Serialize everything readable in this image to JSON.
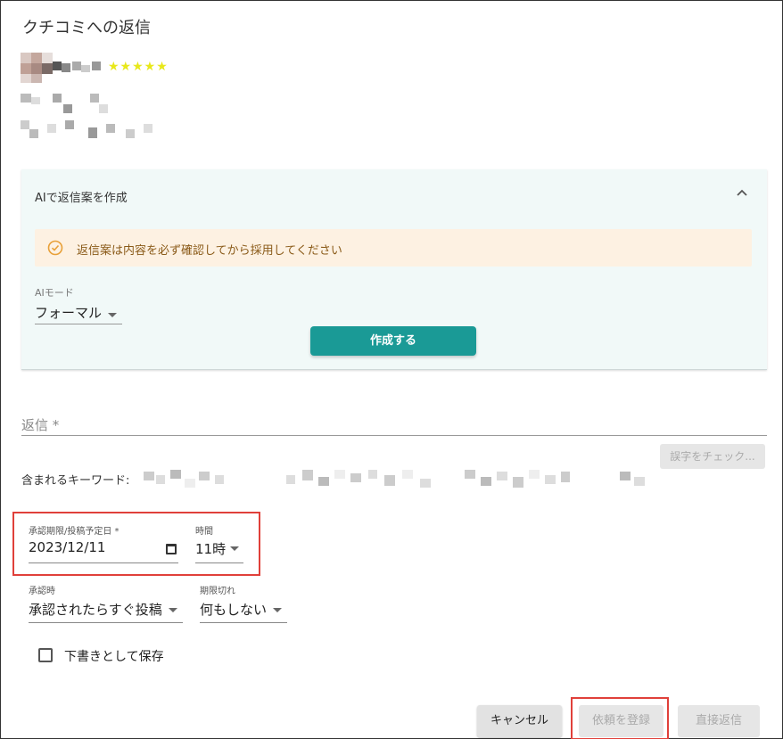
{
  "dialog": {
    "title": "クチコミへの返信"
  },
  "review": {
    "stars": "★★★★★",
    "star_color": "#e8e81a"
  },
  "ai_panel": {
    "title": "AIで返信案を作成",
    "notice": "返信案は内容を必ず確認してから採用してください",
    "mode_label": "AIモード",
    "mode_value": "フォーマル",
    "create_button": "作成する",
    "accent_color": "#1a9a96"
  },
  "reply": {
    "label": "返信 *",
    "spellcheck_button": "誤字をチェック...",
    "keywords_label": "含まれるキーワード:"
  },
  "schedule": {
    "date_label": "承認期限/投稿予定日 *",
    "date_value": "2023/12/11",
    "time_label": "時間",
    "time_value": "11時",
    "on_approve_label": "承認時",
    "on_approve_value": "承認されたらすぐ投稿",
    "on_expire_label": "期限切れ",
    "on_expire_value": "何もしない"
  },
  "draft": {
    "label": "下書きとして保存"
  },
  "actions": {
    "cancel": "キャンセル",
    "register": "依頼を登録",
    "direct_reply": "直接返信"
  },
  "highlight_color": "#e0403a"
}
